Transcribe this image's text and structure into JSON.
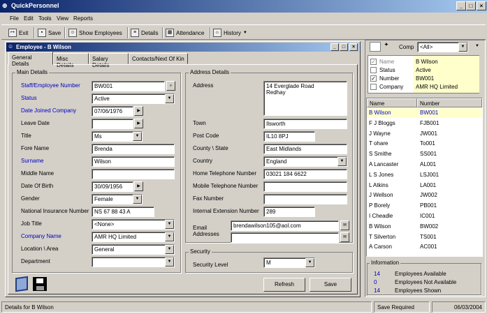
{
  "app": {
    "title": "QuickPersonnel"
  },
  "menu": [
    "File",
    "Edit",
    "Tools",
    "View",
    "Reports"
  ],
  "toolbar": {
    "exit": "Exit",
    "save": "Save",
    "show_employees": "Show Employees",
    "details": "Details",
    "attendance": "Attendance",
    "history": "History"
  },
  "child": {
    "title": "Employee - B Wilson"
  },
  "tabs": [
    "General Details",
    "Misc Details",
    "Salary Details",
    "Contacts/Next Of Kin"
  ],
  "main_details": {
    "group": "Main Details",
    "staff_id_label": "Staff/Employee Number",
    "staff_id": "BW001",
    "status_label": "Status",
    "status": "Active",
    "date_joined_label": "Date Joined Company",
    "date_joined": "07/06/1976",
    "leave_date_label": "Leave Date",
    "leave_date": "",
    "title_label": "Title",
    "title": "Ms",
    "fore_name_label": "Fore Name",
    "fore_name": "Brenda",
    "surname_label": "Surname",
    "surname": "Wilson",
    "middle_name_label": "Middle Name",
    "middle_name": "",
    "dob_label": "Date Of Birth",
    "dob": "30/09/1956",
    "gender_label": "Gender",
    "gender": "Female",
    "ni_label": "National Insurance Number",
    "ni": "NS 67 88 43 A",
    "job_title_label": "Job Title",
    "job_title": "<None>",
    "company_label": "Company Name",
    "company": "AMR HQ Limited",
    "location_label": "Location \\ Area",
    "location": "General",
    "department_label": "Department",
    "department": ""
  },
  "address": {
    "group": "Address Details",
    "address_label": "Address",
    "address_line1": "14 Everglade Road",
    "address_line2": "Redhay",
    "town_label": "Town",
    "town": "Ilsworth",
    "postcode_label": "Post Code",
    "postcode": "IL10 8PJ",
    "county_label": "County \\ State",
    "county": "East Midlands",
    "country_label": "Country",
    "country": "England",
    "home_tel_label": "Home Telephone Number",
    "home_tel": "03021 184 6622",
    "mobile_label": "Mobile Telephone Number",
    "mobile": "",
    "fax_label": "Fax Number",
    "fax": "",
    "ext_label": "Internal Extension Number",
    "ext": "289",
    "email_label": "Email Addresses",
    "email1": "brendawilson105@aol.com",
    "email2": ""
  },
  "security": {
    "group": "Security",
    "level_label": "Security Level",
    "level": "M"
  },
  "buttons": {
    "refresh": "Refresh",
    "save": "Save"
  },
  "filter": {
    "comp_label": "Comp",
    "comp_value": "<All>",
    "fields": [
      {
        "label": "Name",
        "value": "B  Wilson",
        "checked": true,
        "disabled": true
      },
      {
        "label": "Status",
        "value": "Active",
        "checked": false,
        "disabled": false
      },
      {
        "label": "Number",
        "value": "BW001",
        "checked": true,
        "disabled": false
      },
      {
        "label": "Company",
        "value": "AMR HQ Limited",
        "checked": false,
        "disabled": false
      }
    ]
  },
  "list": {
    "col_name": "Name",
    "col_number": "Number",
    "rows": [
      {
        "name": "B Wilson",
        "number": "BW001"
      },
      {
        "name": "F J Bloggs",
        "number": "FJB001"
      },
      {
        "name": "J  Wayne",
        "number": "JW001"
      },
      {
        "name": "T  ohare",
        "number": "To001"
      },
      {
        "name": "S  Smithe",
        "number": "SS001"
      },
      {
        "name": "A  Lancaster",
        "number": "AL001"
      },
      {
        "name": "L S Jones",
        "number": "LSJ001"
      },
      {
        "name": "L  Atkins",
        "number": "LA001"
      },
      {
        "name": "J  Wellson",
        "number": "JW002"
      },
      {
        "name": "P  Borely",
        "number": "PB001"
      },
      {
        "name": "I  Cheadle",
        "number": "IC001"
      },
      {
        "name": "B  Wilson",
        "number": "BW002"
      },
      {
        "name": "T  Silverton",
        "number": "TS001"
      },
      {
        "name": "A  Carson",
        "number": "AC001"
      }
    ]
  },
  "info": {
    "group": "Information",
    "rows": [
      {
        "count": "14",
        "label": "Employees Available"
      },
      {
        "count": "0",
        "label": "Employees Not Available"
      },
      {
        "count": "14",
        "label": "Employees Shown"
      }
    ]
  },
  "status": {
    "details": "Details for B  Wilson",
    "save_required": "Save Required",
    "date": "06/03/2004"
  },
  "colors": {
    "title_start": "#0a246a",
    "title_end": "#a6caf0",
    "highlight": "#ffffcc",
    "label_blue": "#0000c0"
  }
}
